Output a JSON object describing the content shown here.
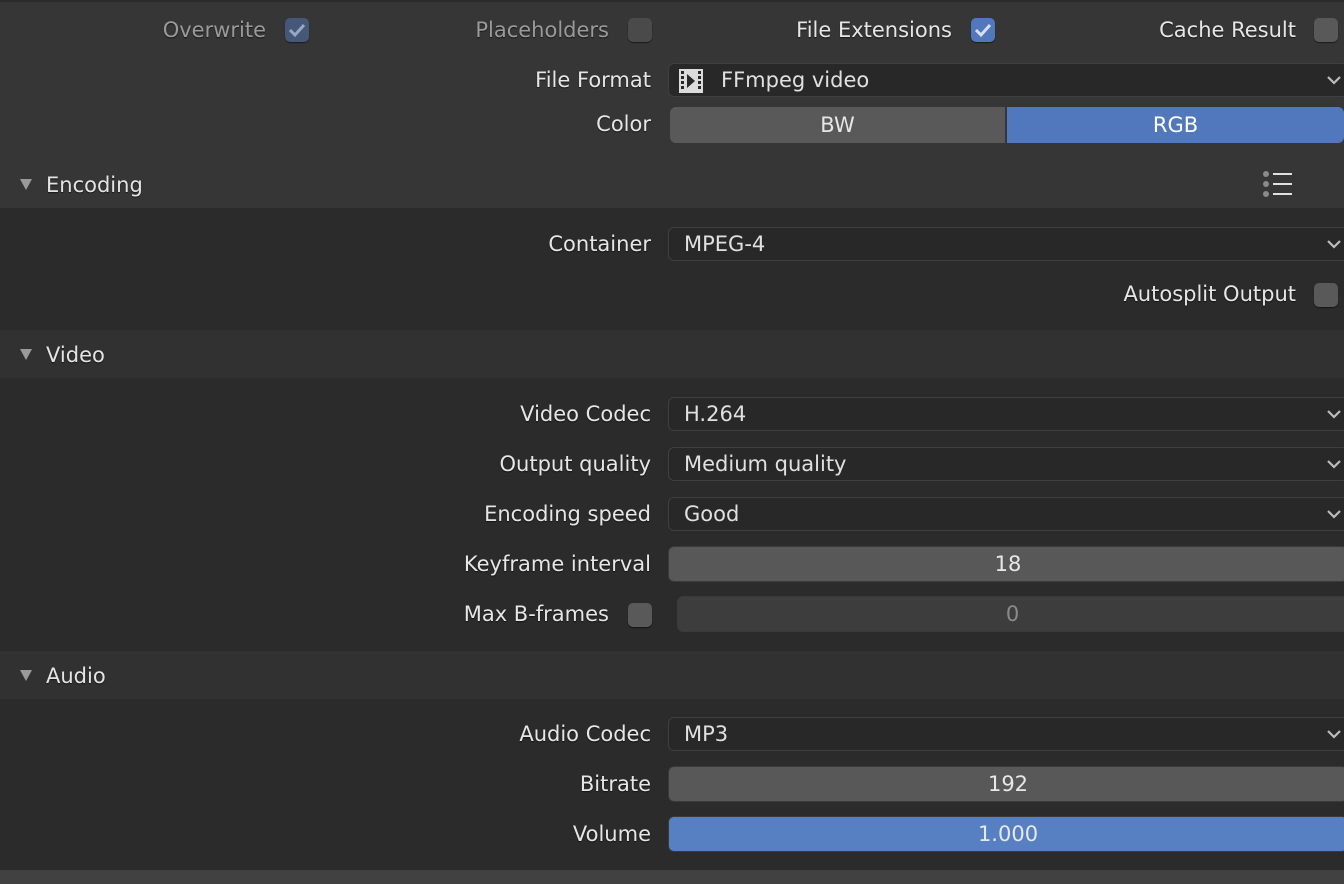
{
  "output_options": {
    "overwrite": {
      "label": "Overwrite",
      "checked": true,
      "enabled": false
    },
    "placeholders": {
      "label": "Placeholders",
      "checked": false,
      "enabled": false
    },
    "file_extensions": {
      "label": "File Extensions",
      "checked": true
    },
    "cache_result": {
      "label": "Cache Result",
      "checked": false
    },
    "file_format": {
      "label": "File Format",
      "value": "FFmpeg video",
      "icon": "film-icon"
    },
    "color": {
      "label": "Color",
      "options": [
        "BW",
        "RGB"
      ],
      "selected": "RGB"
    }
  },
  "encoding": {
    "title": "Encoding",
    "expanded": true,
    "presets_icon": "list-icon",
    "container": {
      "label": "Container",
      "value": "MPEG-4"
    },
    "autosplit": {
      "label": "Autosplit Output",
      "checked": false
    }
  },
  "video": {
    "title": "Video",
    "expanded": true,
    "codec": {
      "label": "Video Codec",
      "value": "H.264"
    },
    "quality": {
      "label": "Output quality",
      "value": "Medium quality"
    },
    "speed": {
      "label": "Encoding speed",
      "value": "Good"
    },
    "keyframe": {
      "label": "Keyframe interval",
      "value": "18"
    },
    "bframes": {
      "label": "Max B-frames",
      "checked": false,
      "value": "0"
    }
  },
  "audio": {
    "title": "Audio",
    "expanded": true,
    "codec": {
      "label": "Audio Codec",
      "value": "MP3"
    },
    "bitrate": {
      "label": "Bitrate",
      "value": "192"
    },
    "volume": {
      "label": "Volume",
      "value": "1.000"
    }
  },
  "colors": {
    "accent": "#5178bd",
    "panel": "#363636",
    "body": "#2b2b2b"
  }
}
